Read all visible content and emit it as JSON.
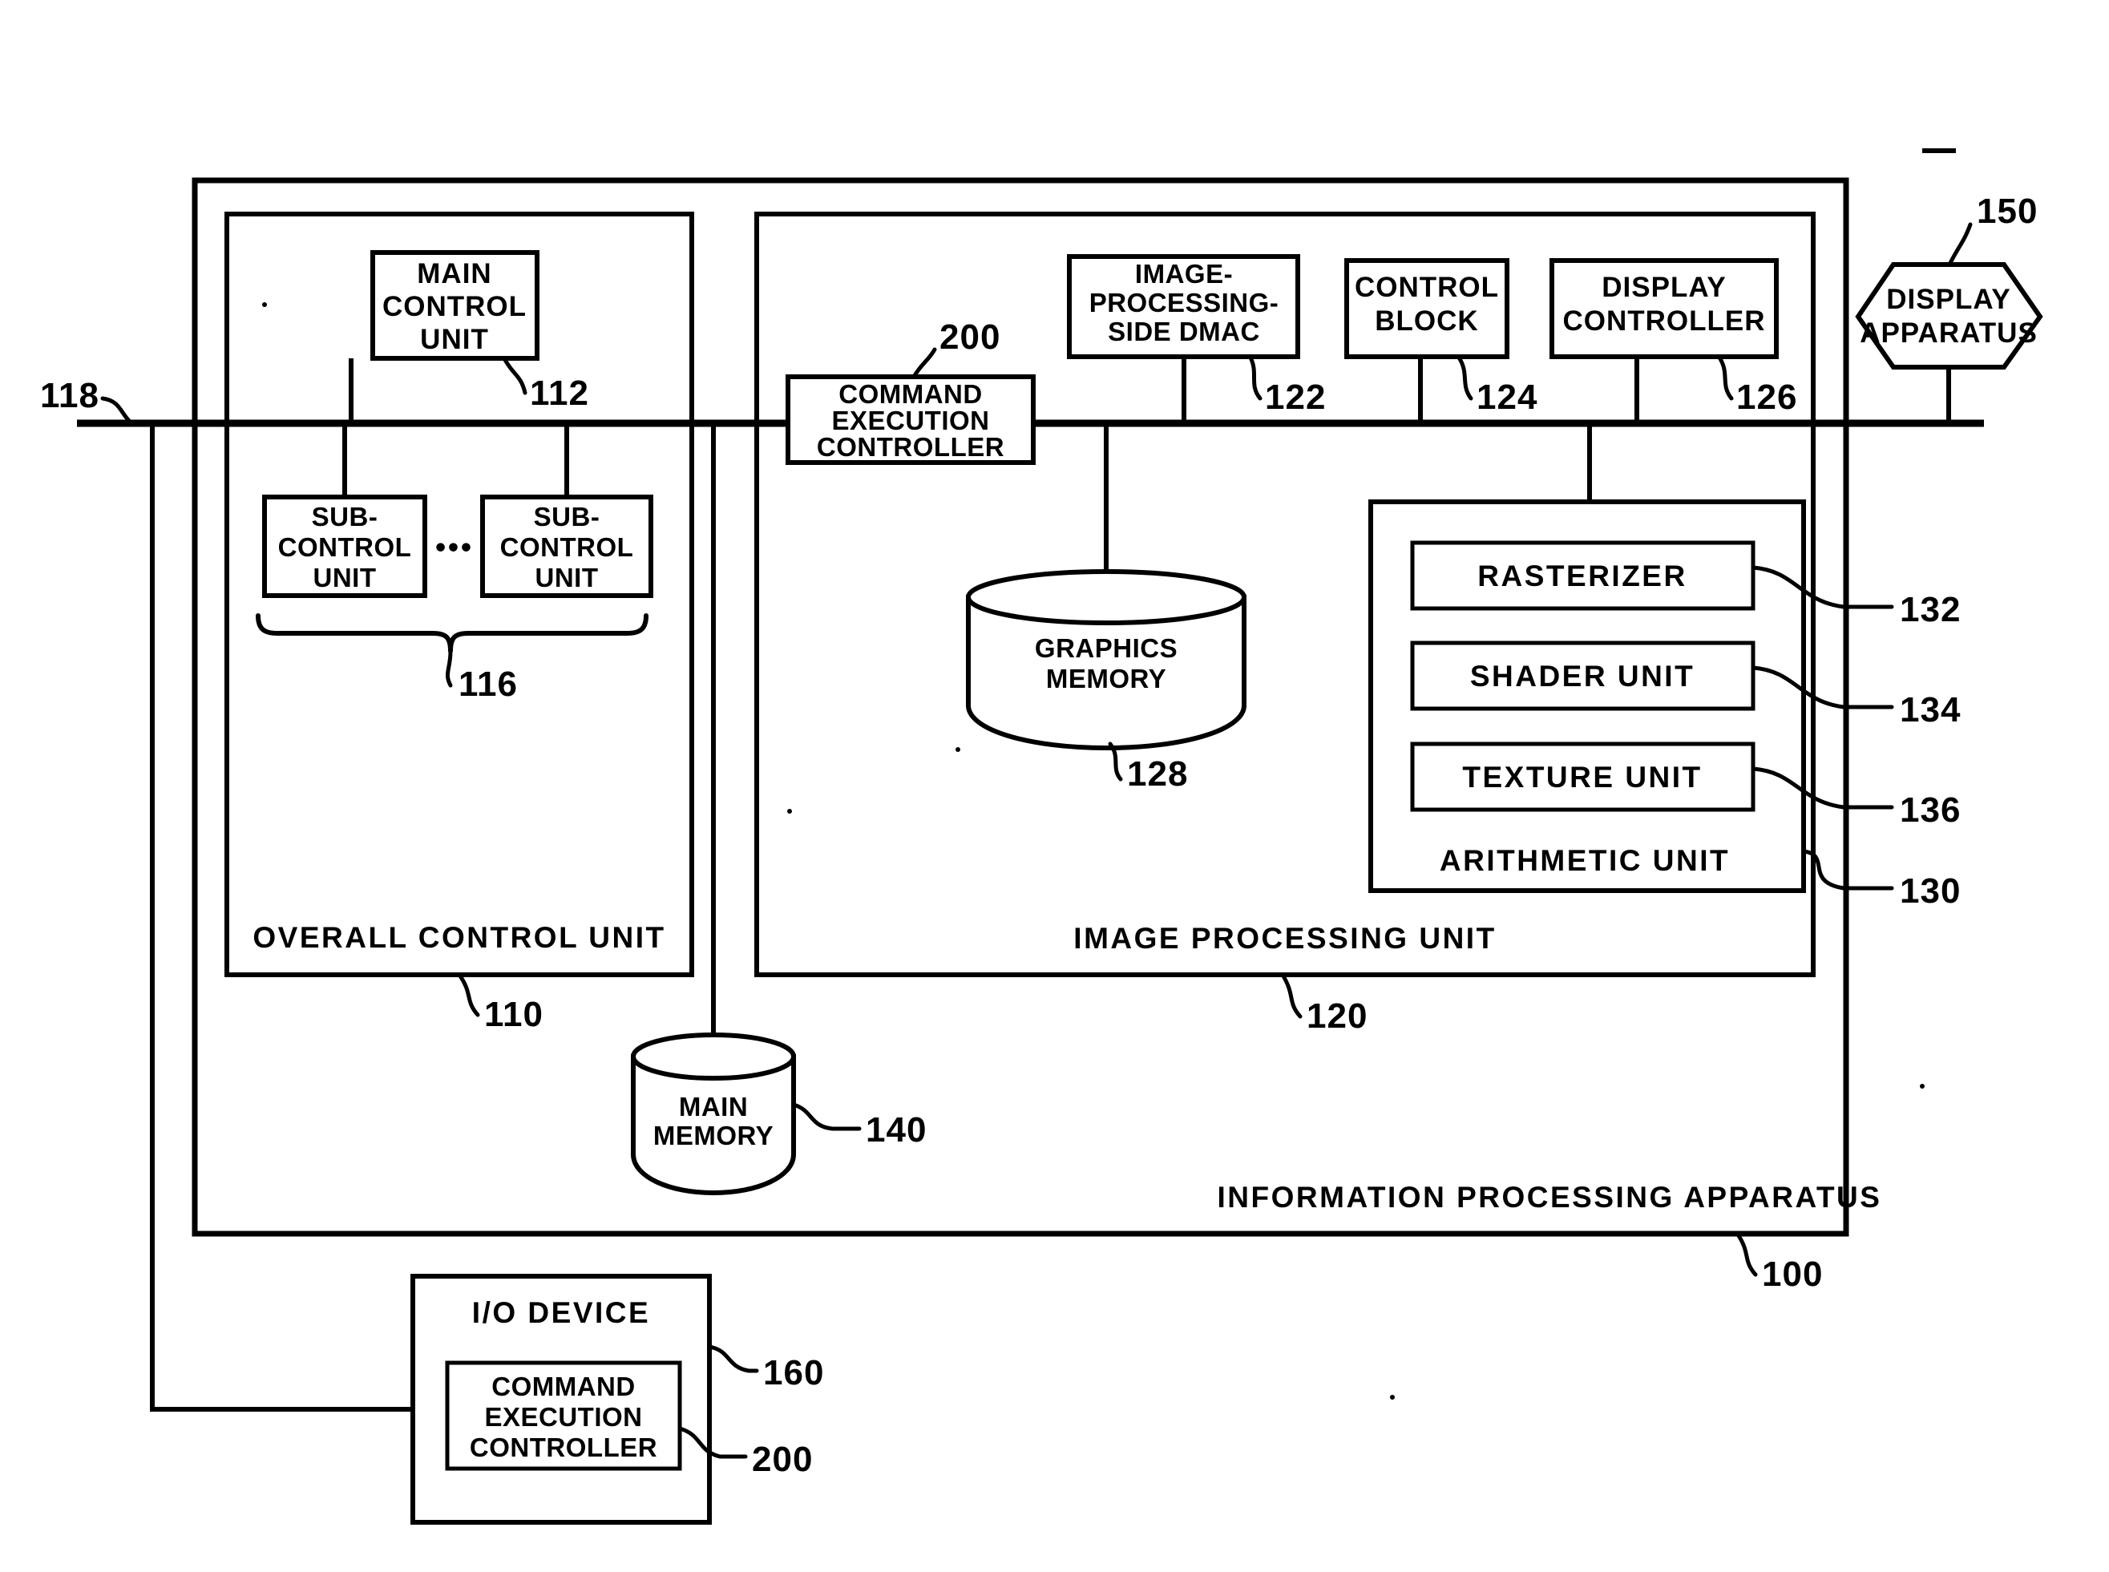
{
  "figure": {
    "kind": "patent-block-diagram",
    "background_color": "#ffffff",
    "line_color": "#000000"
  },
  "outer": {
    "label": "INFORMATION PROCESSING APPARATUS",
    "ref": "100"
  },
  "overall_control_unit": {
    "label": "OVERALL CONTROL UNIT",
    "ref": "110",
    "main_control_unit": {
      "label_line1": "MAIN",
      "label_line2": "CONTROL",
      "label_line3": "UNIT",
      "ref": "112"
    },
    "sub_control_unit_left": {
      "label_line1": "SUB-",
      "label_line2": "CONTROL",
      "label_line3": "UNIT"
    },
    "sub_control_unit_right": {
      "label_line1": "SUB-",
      "label_line2": "CONTROL",
      "label_line3": "UNIT"
    },
    "ellipsis": "•••",
    "sub_control_group_ref": "116"
  },
  "image_processing_unit": {
    "label": "IMAGE PROCESSING UNIT",
    "ref": "120",
    "command_execution_controller": {
      "label_line1": "COMMAND",
      "label_line2": "EXECUTION",
      "label_line3": "CONTROLLER",
      "ref": "200"
    },
    "image_processing_side_dmac": {
      "label_line1": "IMAGE-",
      "label_line2": "PROCESSING-",
      "label_line3": "SIDE DMAC",
      "ref": "122"
    },
    "control_block": {
      "label_line1": "CONTROL",
      "label_line2": "BLOCK",
      "ref": "124"
    },
    "display_controller": {
      "label_line1": "DISPLAY",
      "label_line2": "CONTROLLER",
      "ref": "126"
    },
    "graphics_memory": {
      "label_line1": "GRAPHICS",
      "label_line2": "MEMORY",
      "ref": "128"
    },
    "arithmetic_unit": {
      "label": "ARITHMETIC UNIT",
      "ref": "130",
      "rasterizer": {
        "label": "RASTERIZER",
        "ref": "132"
      },
      "shader_unit": {
        "label": "SHADER UNIT",
        "ref": "134"
      },
      "texture_unit": {
        "label": "TEXTURE UNIT",
        "ref": "136"
      }
    }
  },
  "main_memory": {
    "label_line1": "MAIN",
    "label_line2": "MEMORY",
    "ref": "140"
  },
  "display_apparatus": {
    "label_line1": "DISPLAY",
    "label_line2": "APPARATUS",
    "ref": "150"
  },
  "io_device": {
    "label": "I/O DEVICE",
    "ref": "160",
    "command_execution_controller": {
      "label_line1": "COMMAND",
      "label_line2": "EXECUTION",
      "label_line3": "CONTROLLER",
      "ref": "200"
    }
  },
  "bus": {
    "ref": "118"
  }
}
